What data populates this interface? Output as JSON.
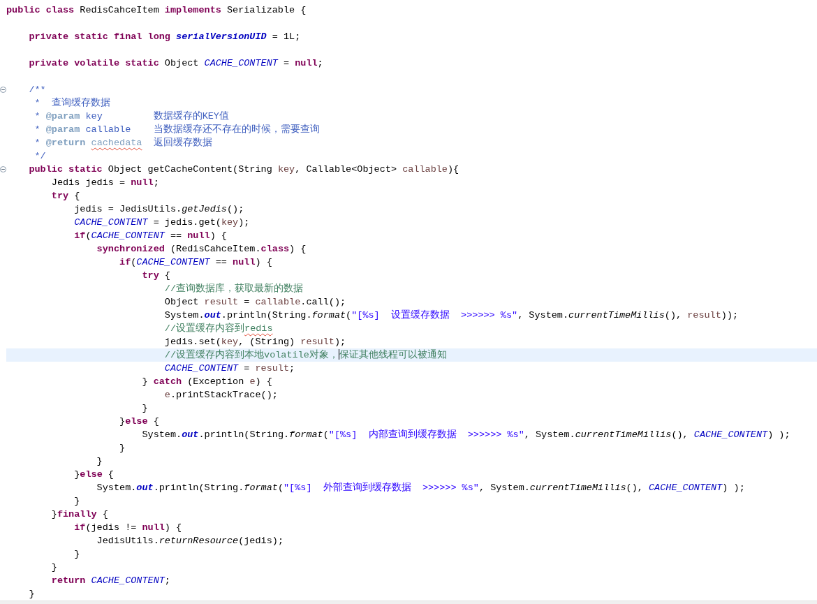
{
  "lines": [
    {
      "tokens": [
        {
          "kind": "k",
          "text": "public class"
        },
        {
          "kind": "t",
          "text": " RedisCahceItem "
        },
        {
          "kind": "k",
          "text": "implements"
        },
        {
          "kind": "t",
          "text": " Serializable {"
        }
      ]
    },
    {
      "gap_before": true,
      "tokens": [
        {
          "kind": "k",
          "text": "    private static final long "
        },
        {
          "kind": "sf",
          "text": "serialVersionUID"
        },
        {
          "kind": "t",
          "text": " = 1L;"
        }
      ]
    },
    {
      "gap_before": true,
      "tokens": [
        {
          "kind": "k",
          "text": "    private volatile static"
        },
        {
          "kind": "t",
          "text": " Object "
        },
        {
          "kind": "f",
          "text": "CACHE_CONTENT"
        },
        {
          "kind": "t",
          "text": " = "
        },
        {
          "kind": "k",
          "text": "null"
        },
        {
          "kind": "t",
          "text": ";"
        }
      ]
    },
    {
      "gap_before": true,
      "fold": true,
      "tokens": [
        {
          "kind": "d",
          "text": "    /**"
        }
      ]
    },
    {
      "tokens": [
        {
          "kind": "d",
          "text": "     *  查询缓存数据"
        }
      ]
    },
    {
      "tokens": [
        {
          "kind": "d",
          "text": "     * "
        },
        {
          "kind": "dt",
          "text": "@param"
        },
        {
          "kind": "d",
          "text": " key         数据缓存的KEY值"
        }
      ]
    },
    {
      "tokens": [
        {
          "kind": "d",
          "text": "     * "
        },
        {
          "kind": "dt",
          "text": "@param"
        },
        {
          "kind": "d",
          "text": " callable    当数据缓存还不存在的时候，需要查询"
        }
      ]
    },
    {
      "tokens": [
        {
          "kind": "d",
          "text": "     * "
        },
        {
          "kind": "dt",
          "text": "@return "
        },
        {
          "kind": "ds",
          "text": "cachedata"
        },
        {
          "kind": "d",
          "text": "  返回缓存数据"
        }
      ]
    },
    {
      "tokens": [
        {
          "kind": "d",
          "text": "     */"
        }
      ]
    },
    {
      "fold": true,
      "tokens": [
        {
          "kind": "k",
          "text": "    public static"
        },
        {
          "kind": "t",
          "text": " Object getCacheContent(String "
        },
        {
          "kind": "v",
          "text": "key"
        },
        {
          "kind": "t",
          "text": ", Callable<Object> "
        },
        {
          "kind": "v",
          "text": "callable"
        },
        {
          "kind": "t",
          "text": "){"
        }
      ]
    },
    {
      "tokens": [
        {
          "kind": "t",
          "text": "        Jedis jedis = "
        },
        {
          "kind": "k",
          "text": "null"
        },
        {
          "kind": "t",
          "text": ";"
        }
      ]
    },
    {
      "tokens": [
        {
          "kind": "k",
          "text": "        try"
        },
        {
          "kind": "t",
          "text": " {"
        }
      ]
    },
    {
      "tokens": [
        {
          "kind": "t",
          "text": "            jedis = JedisUtils."
        },
        {
          "kind": "sm",
          "text": "getJedis"
        },
        {
          "kind": "t",
          "text": "();"
        }
      ]
    },
    {
      "tokens": [
        {
          "kind": "f",
          "text": "            CACHE_CONTENT"
        },
        {
          "kind": "t",
          "text": " = jedis.get("
        },
        {
          "kind": "v",
          "text": "key"
        },
        {
          "kind": "t",
          "text": ");"
        }
      ]
    },
    {
      "tokens": [
        {
          "kind": "k",
          "text": "            if"
        },
        {
          "kind": "t",
          "text": "("
        },
        {
          "kind": "f",
          "text": "CACHE_CONTENT"
        },
        {
          "kind": "t",
          "text": " == "
        },
        {
          "kind": "k",
          "text": "null"
        },
        {
          "kind": "t",
          "text": ") {"
        }
      ]
    },
    {
      "tokens": [
        {
          "kind": "k",
          "text": "                synchronized"
        },
        {
          "kind": "t",
          "text": " (RedisCahceItem."
        },
        {
          "kind": "k",
          "text": "class"
        },
        {
          "kind": "t",
          "text": ") {"
        }
      ]
    },
    {
      "tokens": [
        {
          "kind": "k",
          "text": "                    if"
        },
        {
          "kind": "t",
          "text": "("
        },
        {
          "kind": "f",
          "text": "CACHE_CONTENT"
        },
        {
          "kind": "t",
          "text": " == "
        },
        {
          "kind": "k",
          "text": "null"
        },
        {
          "kind": "t",
          "text": ") {"
        }
      ]
    },
    {
      "tokens": [
        {
          "kind": "k",
          "text": "                        try"
        },
        {
          "kind": "t",
          "text": " {"
        }
      ]
    },
    {
      "tokens": [
        {
          "kind": "c",
          "text": "                            //查询数据库，获取最新的数据"
        }
      ]
    },
    {
      "tokens": [
        {
          "kind": "t",
          "text": "                            Object "
        },
        {
          "kind": "v",
          "text": "result"
        },
        {
          "kind": "t",
          "text": " = "
        },
        {
          "kind": "v",
          "text": "callable"
        },
        {
          "kind": "t",
          "text": ".call();"
        }
      ]
    },
    {
      "tokens": [
        {
          "kind": "t",
          "text": "                            System."
        },
        {
          "kind": "sf",
          "text": "out"
        },
        {
          "kind": "t",
          "text": ".println(String."
        },
        {
          "kind": "sm",
          "text": "format"
        },
        {
          "kind": "t",
          "text": "("
        },
        {
          "kind": "s",
          "text": "\"[%s]  设置缓存数据  >>>>>> %s\""
        },
        {
          "kind": "t",
          "text": ", System."
        },
        {
          "kind": "sm",
          "text": "currentTimeMillis"
        },
        {
          "kind": "t",
          "text": "(), "
        },
        {
          "kind": "v",
          "text": "result"
        },
        {
          "kind": "t",
          "text": "));"
        }
      ]
    },
    {
      "tokens": [
        {
          "kind": "c",
          "text": "                            //设置缓存内容到"
        },
        {
          "kind": "cs",
          "text": "redis"
        }
      ]
    },
    {
      "tokens": [
        {
          "kind": "t",
          "text": "                            jedis.set("
        },
        {
          "kind": "v",
          "text": "key"
        },
        {
          "kind": "t",
          "text": ", (String) "
        },
        {
          "kind": "v",
          "text": "result"
        },
        {
          "kind": "t",
          "text": ");"
        }
      ]
    },
    {
      "current": true,
      "tokens": [
        {
          "kind": "c",
          "text": "                            //设置缓存内容到本地volatile对象，"
        },
        {
          "kind": "caret"
        },
        {
          "kind": "c",
          "text": "保证其他线程可以被通知"
        }
      ]
    },
    {
      "tokens": [
        {
          "kind": "f",
          "text": "                            CACHE_CONTENT"
        },
        {
          "kind": "t",
          "text": " = "
        },
        {
          "kind": "v",
          "text": "result"
        },
        {
          "kind": "t",
          "text": ";"
        }
      ]
    },
    {
      "tokens": [
        {
          "kind": "t",
          "text": "                        } "
        },
        {
          "kind": "k",
          "text": "catch"
        },
        {
          "kind": "t",
          "text": " (Exception "
        },
        {
          "kind": "v",
          "text": "e"
        },
        {
          "kind": "t",
          "text": ") {"
        }
      ]
    },
    {
      "tokens": [
        {
          "kind": "v",
          "text": "                            e"
        },
        {
          "kind": "t",
          "text": ".printStackTrace();"
        }
      ]
    },
    {
      "tokens": [
        {
          "kind": "t",
          "text": "                        }"
        }
      ]
    },
    {
      "tokens": [
        {
          "kind": "t",
          "text": "                    }"
        },
        {
          "kind": "k",
          "text": "else"
        },
        {
          "kind": "t",
          "text": " {"
        }
      ]
    },
    {
      "tokens": [
        {
          "kind": "t",
          "text": "                        System."
        },
        {
          "kind": "sf",
          "text": "out"
        },
        {
          "kind": "t",
          "text": ".println(String."
        },
        {
          "kind": "sm",
          "text": "format"
        },
        {
          "kind": "t",
          "text": "("
        },
        {
          "kind": "s",
          "text": "\"[%s]  内部查询到缓存数据  >>>>>> %s\""
        },
        {
          "kind": "t",
          "text": ", System."
        },
        {
          "kind": "sm",
          "text": "currentTimeMillis"
        },
        {
          "kind": "t",
          "text": "(), "
        },
        {
          "kind": "f",
          "text": "CACHE_CONTENT"
        },
        {
          "kind": "t",
          "text": ") );"
        }
      ]
    },
    {
      "tokens": [
        {
          "kind": "t",
          "text": "                    }"
        }
      ]
    },
    {
      "tokens": [
        {
          "kind": "t",
          "text": "                }"
        }
      ]
    },
    {
      "tokens": [
        {
          "kind": "t",
          "text": "            }"
        },
        {
          "kind": "k",
          "text": "else"
        },
        {
          "kind": "t",
          "text": " {"
        }
      ]
    },
    {
      "tokens": [
        {
          "kind": "t",
          "text": "                System."
        },
        {
          "kind": "sf",
          "text": "out"
        },
        {
          "kind": "t",
          "text": ".println(String."
        },
        {
          "kind": "sm",
          "text": "format"
        },
        {
          "kind": "t",
          "text": "("
        },
        {
          "kind": "s",
          "text": "\"[%s]  外部查询到缓存数据  >>>>>> %s\""
        },
        {
          "kind": "t",
          "text": ", System."
        },
        {
          "kind": "sm",
          "text": "currentTimeMillis"
        },
        {
          "kind": "t",
          "text": "(), "
        },
        {
          "kind": "f",
          "text": "CACHE_CONTENT"
        },
        {
          "kind": "t",
          "text": ") );"
        }
      ]
    },
    {
      "tokens": [
        {
          "kind": "t",
          "text": "            }"
        }
      ]
    },
    {
      "tokens": [
        {
          "kind": "t",
          "text": "        }"
        },
        {
          "kind": "k",
          "text": "finally"
        },
        {
          "kind": "t",
          "text": " {"
        }
      ]
    },
    {
      "tokens": [
        {
          "kind": "k",
          "text": "            if"
        },
        {
          "kind": "t",
          "text": "(jedis != "
        },
        {
          "kind": "k",
          "text": "null"
        },
        {
          "kind": "t",
          "text": ") {"
        }
      ]
    },
    {
      "tokens": [
        {
          "kind": "t",
          "text": "                JedisUtils."
        },
        {
          "kind": "sm",
          "text": "returnResource"
        },
        {
          "kind": "t",
          "text": "(jedis);"
        }
      ]
    },
    {
      "tokens": [
        {
          "kind": "t",
          "text": "            }"
        }
      ]
    },
    {
      "tokens": [
        {
          "kind": "t",
          "text": "        }"
        }
      ]
    },
    {
      "tokens": [
        {
          "kind": "k",
          "text": "        return "
        },
        {
          "kind": "f",
          "text": "CACHE_CONTENT"
        },
        {
          "kind": "t",
          "text": ";"
        }
      ]
    },
    {
      "tokens": [
        {
          "kind": "t",
          "text": "    }"
        }
      ]
    }
  ]
}
